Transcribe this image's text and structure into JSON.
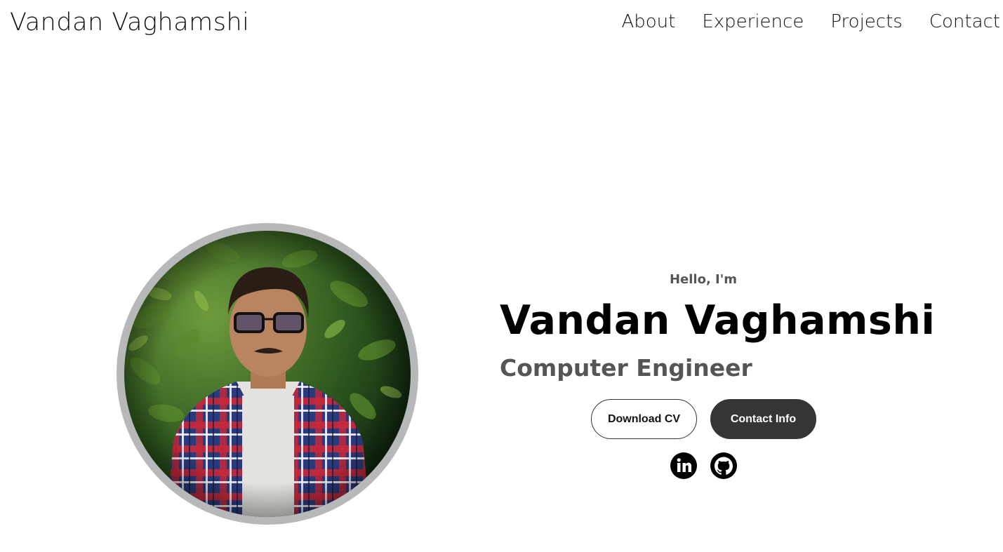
{
  "nav": {
    "logo": "Vandan Vaghamshi",
    "links": [
      "About",
      "Experience",
      "Projects",
      "Contact"
    ]
  },
  "hero": {
    "greeting": "Hello, I'm",
    "name": "Vandan Vaghamshi",
    "role": "Computer Engineer",
    "buttons": {
      "download": "Download CV",
      "contact": "Contact Info"
    },
    "social": {
      "linkedin_icon": "linkedin-icon",
      "github_icon": "github-icon"
    },
    "profile_photo_icon": "profile-photo"
  },
  "colors": {
    "background": "#ffffff",
    "text": "#000000",
    "muted": "#555555",
    "button_dark": "#353535",
    "photo_ring": "#b7b8ba"
  }
}
